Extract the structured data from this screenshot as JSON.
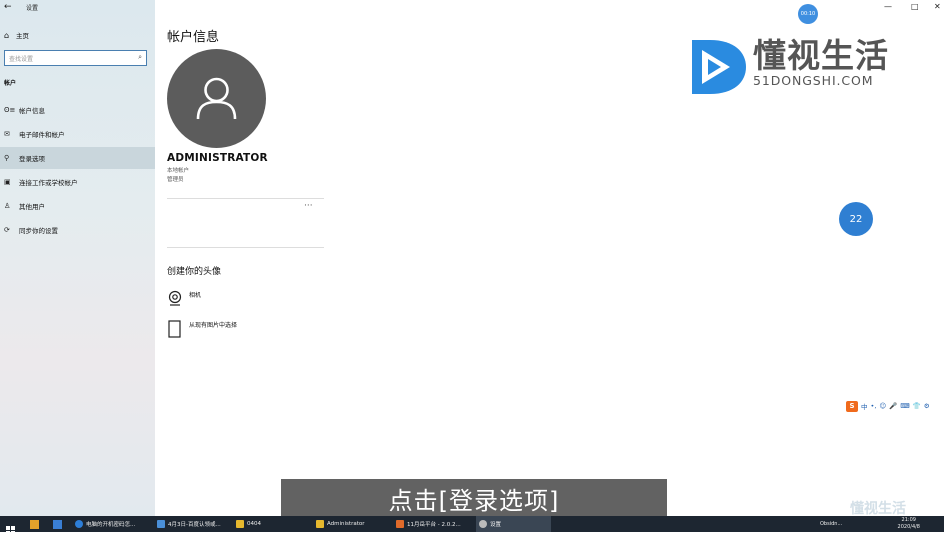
{
  "window": {
    "title": "设置",
    "minimize": "—",
    "maximize": "□",
    "close": "✕"
  },
  "sidebar": {
    "home": "主页",
    "search_placeholder": "查找设置",
    "section": "帐户",
    "items": [
      {
        "label": "帐户信息",
        "icon": "person-card-icon"
      },
      {
        "label": "电子邮件和帐户",
        "icon": "mail-icon"
      },
      {
        "label": "登录选项",
        "icon": "key-icon"
      },
      {
        "label": "连接工作或学校帐户",
        "icon": "briefcase-icon"
      },
      {
        "label": "其他用户",
        "icon": "person-add-icon"
      },
      {
        "label": "同步你的设置",
        "icon": "sync-icon"
      }
    ]
  },
  "main": {
    "title": "帐户信息",
    "account_name": "ADMINISTRATOR",
    "account_type": "本地帐户",
    "account_role": "管理员",
    "more": "···",
    "create_avatar_heading": "创建你的头像",
    "options": [
      {
        "label": "相机",
        "icon": "camera-icon"
      },
      {
        "label": "从现有图片中选择",
        "icon": "picture-icon"
      }
    ]
  },
  "overlay": {
    "record_time": "00:10",
    "logo_cn": "懂视生活",
    "logo_en": "51DONGSHI.COM",
    "weather": "22",
    "subtitle": "点击[登录选项]",
    "watermark": "懂视生活"
  },
  "ime": {
    "brand": "S",
    "items": [
      "中",
      "•,",
      "☺",
      "🎤",
      "⌨",
      "👕",
      "⚙"
    ]
  },
  "taskbar": {
    "apps": [
      {
        "label": "电脑的开机密码怎..."
      },
      {
        "label": "4月3日-百度认领或..."
      },
      {
        "label": "0404"
      },
      {
        "label": "Administrator"
      },
      {
        "label": "11月岳平台 - 2.0.2..."
      },
      {
        "label": "设置"
      }
    ],
    "clock_time": "21:09",
    "clock_date": "2020/4/8",
    "tray_text": "Obsidn..."
  },
  "colors": {
    "accent": "#0078d7",
    "avatar": "#5c5c5c",
    "taskbar": "#1d2631",
    "logo_blue": "#2a8be0"
  }
}
